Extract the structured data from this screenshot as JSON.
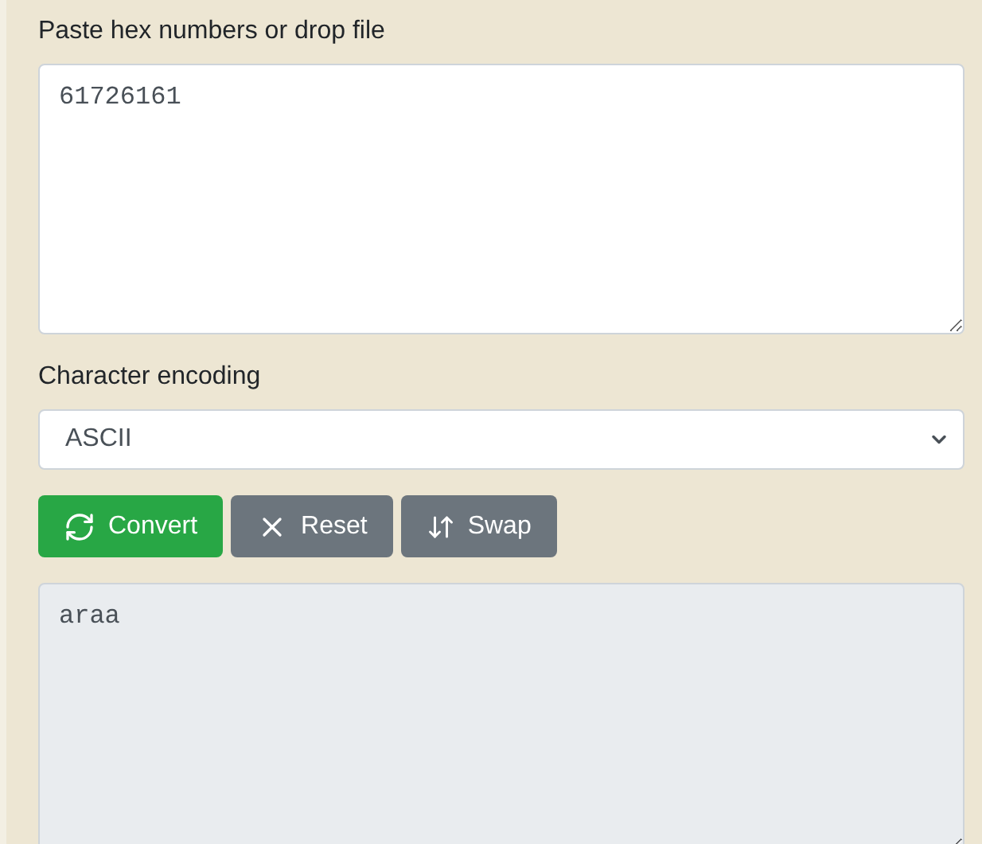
{
  "input": {
    "label": "Paste hex numbers or drop file",
    "value": "61726161"
  },
  "encoding": {
    "label": "Character encoding",
    "value": "ASCII"
  },
  "buttons": [
    {
      "label": "Convert",
      "kind": "convert"
    },
    {
      "label": "Reset",
      "kind": "reset"
    },
    {
      "label": "Swap",
      "kind": "swap"
    }
  ],
  "output": {
    "value": "araa"
  }
}
